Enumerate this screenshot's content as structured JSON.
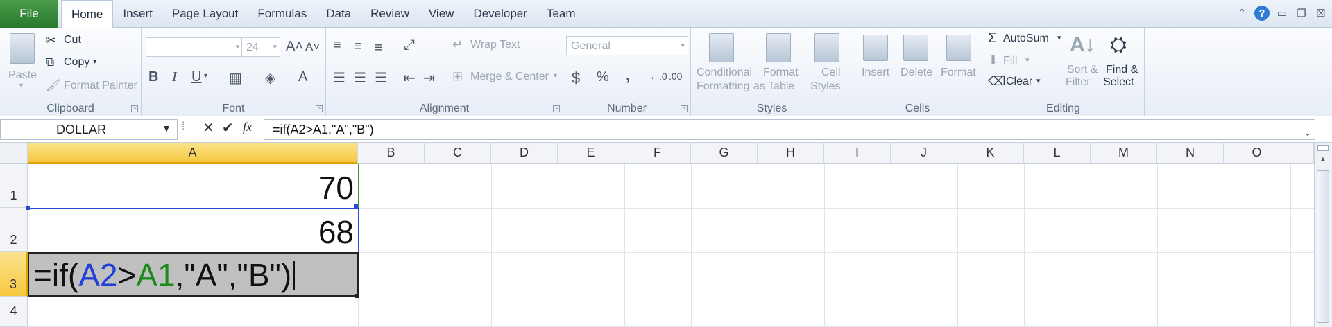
{
  "file_tab": "File",
  "tabs": [
    "Home",
    "Insert",
    "Page Layout",
    "Formulas",
    "Data",
    "Review",
    "View",
    "Developer",
    "Team"
  ],
  "active_tab": "Home",
  "ribbon": {
    "clipboard": {
      "label": "Clipboard",
      "paste": "Paste",
      "cut": "Cut",
      "copy": "Copy",
      "format_painter": "Format Painter"
    },
    "font": {
      "label": "Font",
      "font_size": "24",
      "bold": "B",
      "italic": "I",
      "underline": "U"
    },
    "alignment": {
      "label": "Alignment",
      "wrap_text": "Wrap Text",
      "merge_center": "Merge & Center"
    },
    "number": {
      "label": "Number",
      "format": "General",
      "currency": "$",
      "percent": "%",
      "comma": ","
    },
    "styles": {
      "label": "Styles",
      "conditional_1": "Conditional",
      "conditional_2": "Formatting",
      "format_table_1": "Format",
      "format_table_2": "as Table",
      "cell_styles_1": "Cell",
      "cell_styles_2": "Styles"
    },
    "cells": {
      "label": "Cells",
      "insert": "Insert",
      "delete": "Delete",
      "format": "Format"
    },
    "editing": {
      "label": "Editing",
      "autosum": "AutoSum",
      "fill": "Fill",
      "clear": "Clear",
      "sort_1": "Sort &",
      "sort_2": "Filter",
      "find_1": "Find &",
      "find_2": "Select"
    }
  },
  "name_box": "DOLLAR",
  "formula": "=if(A2>A1,\"A\",\"B\")",
  "columns": [
    "A",
    "B",
    "C",
    "D",
    "E",
    "F",
    "G",
    "H",
    "I",
    "J",
    "K",
    "L",
    "M",
    "N",
    "O"
  ],
  "rows": [
    "1",
    "2",
    "3",
    "4"
  ],
  "cells": {
    "A1": "70",
    "A2": "68",
    "A3": {
      "p1": "=if(",
      "ref1": "A2",
      "op": ">",
      "ref2": "A1",
      "p2": ",\"A\",\"B\")"
    }
  },
  "colors": {
    "ref1": "#1f3fd6",
    "ref2": "#1e8a1e",
    "file_tab": "#2a7a2e",
    "selected_header": "#f6c840"
  }
}
